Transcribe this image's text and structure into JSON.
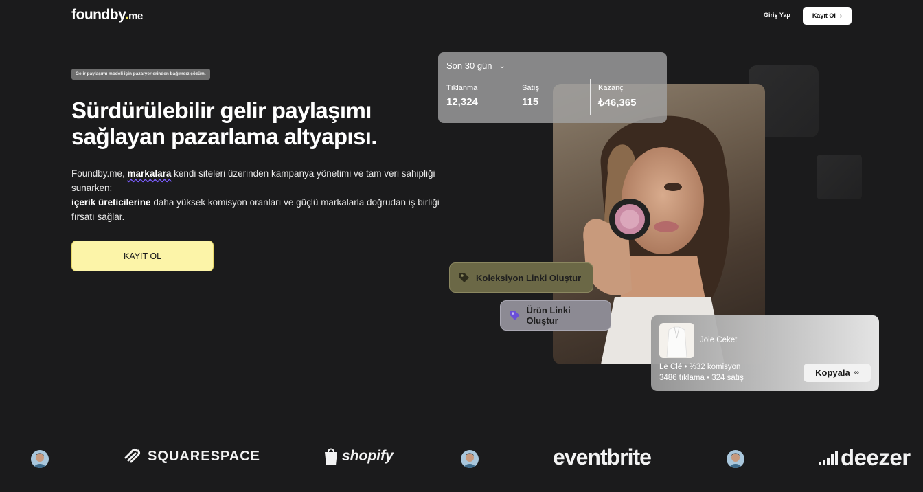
{
  "header": {
    "logo": {
      "main": "foundby",
      "dot": ".",
      "suffix": "me"
    },
    "login_label": "Giriş Yap",
    "signup_label": "Kayıt Ol",
    "signup_icon": "chevron-right-icon"
  },
  "hero": {
    "badge": "Gelir paylaşımı modeli için pazaryerlerinden bağımsız çözüm.",
    "title_line1": "Sürdürülebilir gelir paylaşımı",
    "title_line2": "sağlayan pazarlama altyapısı.",
    "para": {
      "p1_prefix": "Foundby.me, ",
      "p1_highlight": "markalara",
      "p1_suffix": " kendi siteleri üzerinden kampanya yönetimi ve tam veri sahipliği sunarken;",
      "p2_highlight": "içerik üreticilerine",
      "p2_suffix": " daha yüksek komisyon oranları ve güçlü markalarla doğrudan iş birliği fırsatı sağlar."
    },
    "cta_label": "KAYIT OL"
  },
  "stats": {
    "period": "Son 30 gün",
    "items": [
      {
        "label": "Tıklanma",
        "value": "12,324"
      },
      {
        "label": "Satış",
        "value": "115"
      },
      {
        "label": "Kazanç",
        "value": "₺46,365"
      }
    ]
  },
  "actions": {
    "collection_link": "Koleksiyon Linki Oluştur",
    "product_link": "Ürün Linki Oluştur"
  },
  "product_card": {
    "name": "Joie Ceket",
    "brand_line": "Le Clé • %32 komisyon",
    "stats_line": "3486 tıklama • 324 satış",
    "copy_label": "Kopyala"
  },
  "brands": {
    "squarespace": "SQUARESPACE",
    "shopify": "shopify",
    "eventbrite": "eventbrite",
    "deezer": "deezer"
  },
  "colors": {
    "background": "#1b1b1c",
    "accent_yellow": "#fcf4a8",
    "squiggle_purple": "#7a5cff"
  }
}
